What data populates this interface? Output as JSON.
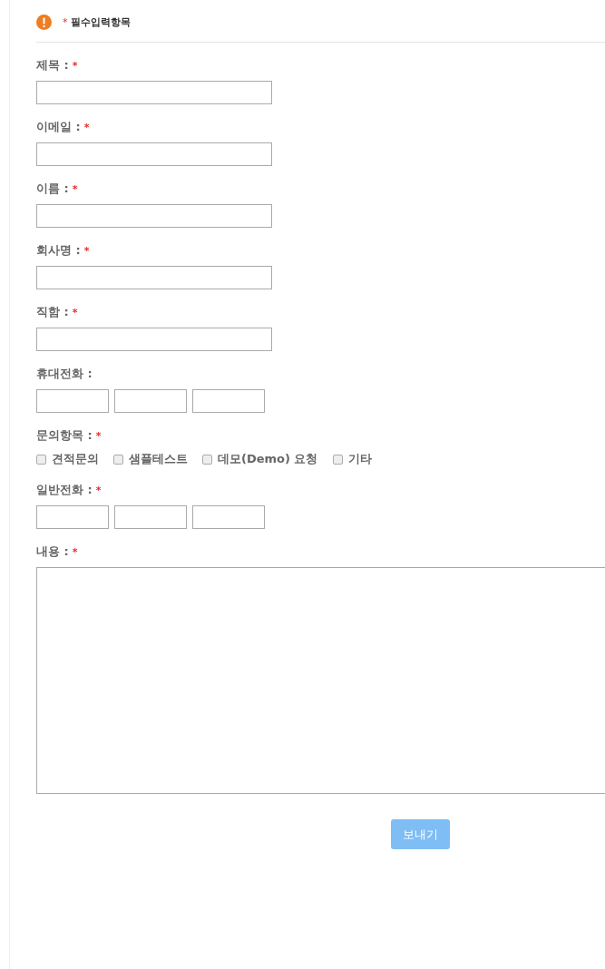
{
  "notice": {
    "mark": "*",
    "text": "필수입력항목"
  },
  "fields": [
    {
      "kind": "text",
      "label": "제목 :",
      "required_mark": "*"
    },
    {
      "kind": "text",
      "label": "이메일 :",
      "required_mark": "*"
    },
    {
      "kind": "text",
      "label": "이름 :",
      "required_mark": "*"
    },
    {
      "kind": "text",
      "label": "회사명 :",
      "required_mark": "*"
    },
    {
      "kind": "text",
      "label": "직함 :",
      "required_mark": "*"
    },
    {
      "kind": "phone",
      "label": "휴대전화 :"
    },
    {
      "kind": "checks",
      "label": "문의항목 :",
      "required_mark": "*",
      "options": [
        {
          "label": "견적문의",
          "checked": false
        },
        {
          "label": "샘플테스트",
          "checked": false
        },
        {
          "label": "데모(Demo) 요청",
          "checked": false
        },
        {
          "label": "기타",
          "checked": false
        }
      ]
    },
    {
      "kind": "phone",
      "label": "일반전화 :",
      "required_mark": "*"
    },
    {
      "kind": "textarea",
      "label": "내용 :",
      "required_mark": "*"
    }
  ],
  "submit": "보내기"
}
